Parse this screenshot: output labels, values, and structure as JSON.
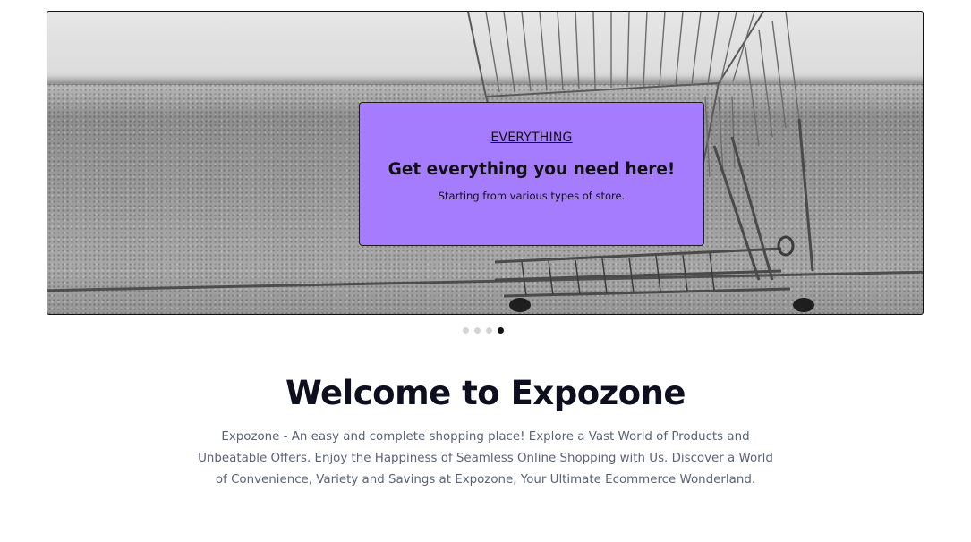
{
  "hero": {
    "banner": {
      "kicker": "EVERYTHING",
      "headline": "Get everything you need here!",
      "subtext": "Starting from various types of store."
    },
    "background_color": "#a67cff",
    "image": "shopping-cart-photo",
    "slides": {
      "count": 4,
      "active_index": 3
    }
  },
  "welcome": {
    "title": "Welcome to Expozone",
    "lines": [
      "Expozone - An easy and complete shopping place! Explore a Vast World of Products and",
      "Unbeatable Offers. Enjoy the Happiness of Seamless Online Shopping with Us. Discover a World",
      "of Convenience, Variety and Savings at Expozone, Your Ultimate Ecommerce Wonderland."
    ]
  },
  "colors": {
    "title": "#0d0f1e",
    "body_text": "#5b6278",
    "dot_inactive": "#d4d4d4",
    "dot_active": "#111111"
  }
}
